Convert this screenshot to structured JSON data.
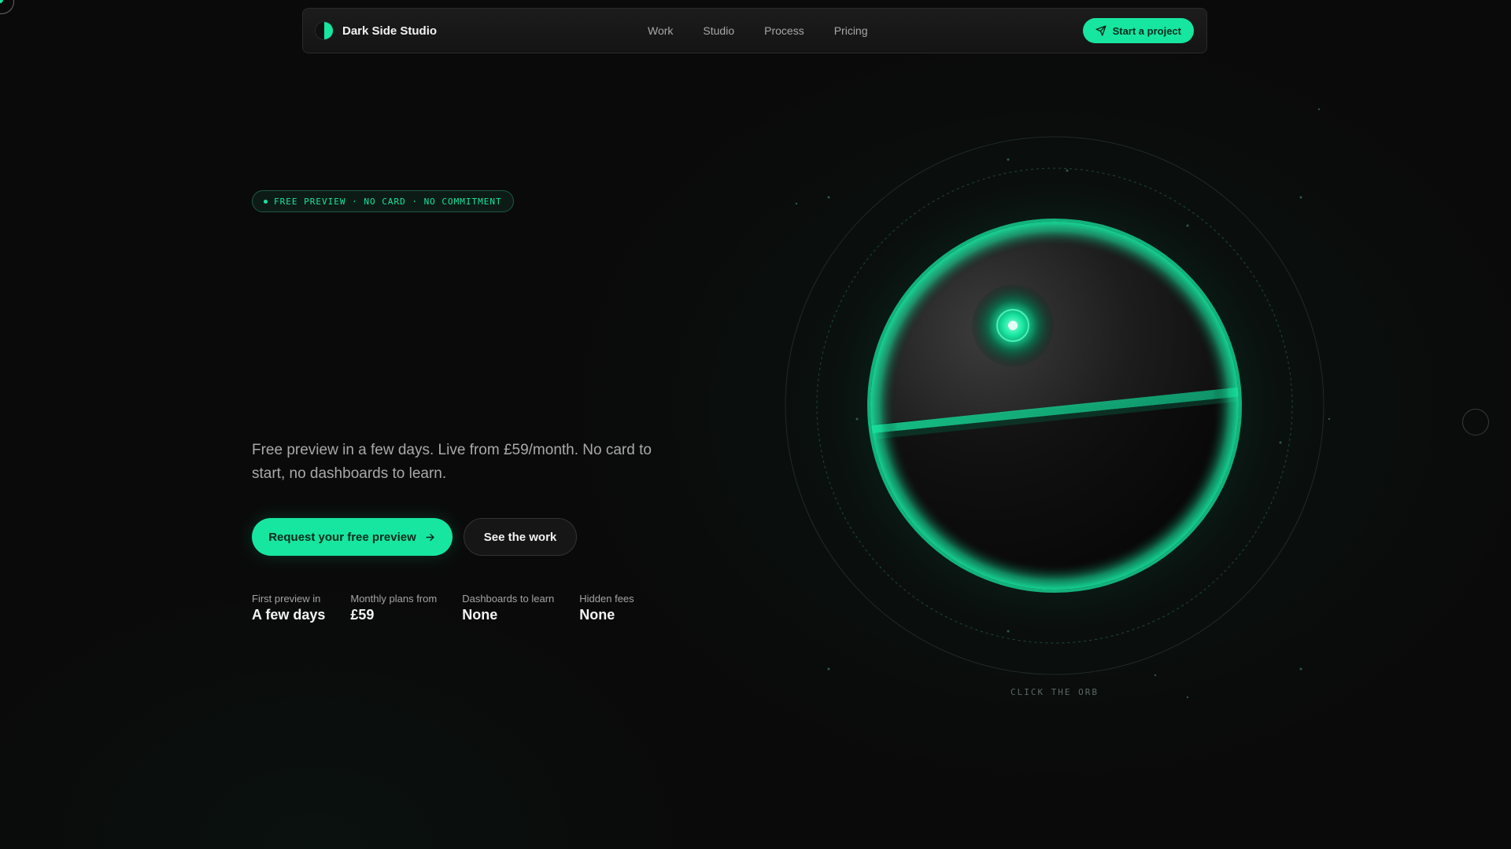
{
  "nav": {
    "brand": "Dark Side Studio",
    "links": [
      "Work",
      "Studio",
      "Process",
      "Pricing"
    ],
    "cta_label": "Start a project"
  },
  "hero": {
    "badge": "FREE PREVIEW · NO CARD · NO COMMITMENT",
    "lede": "Free preview in a few days. Live from £59/month. No card to start, no dashboards to learn.",
    "primary_label": "Request your free preview",
    "secondary_label": "See the work",
    "stats": [
      {
        "label": "First preview in",
        "value": "A few days"
      },
      {
        "label": "Monthly plans from",
        "value": "£59"
      },
      {
        "label": "Dashboards to learn",
        "value": "None"
      },
      {
        "label": "Hidden fees",
        "value": "None"
      }
    ]
  },
  "orb": {
    "caption": "CLICK THE ORB"
  },
  "colors": {
    "accent": "#17e6a0",
    "background": "#0a0a0a"
  },
  "icons": {
    "nav_cta": "send-icon",
    "primary": "arrow-right-icon"
  }
}
